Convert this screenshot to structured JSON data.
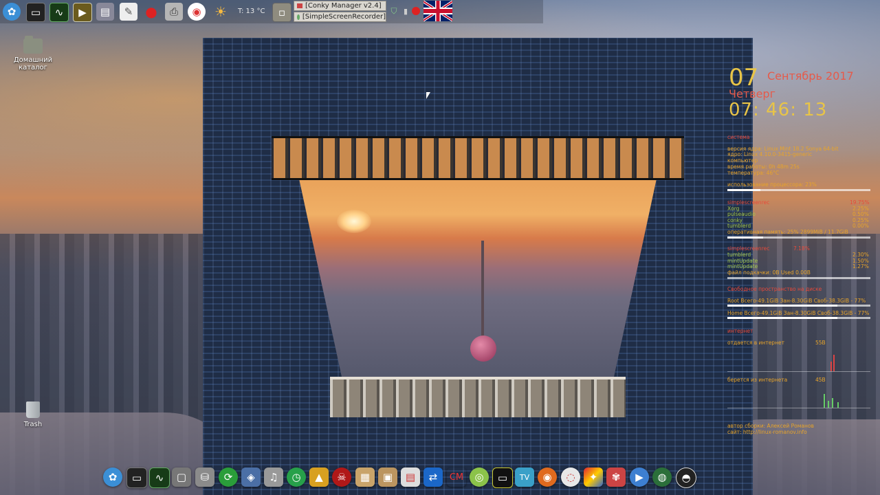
{
  "top_panel": {
    "weather": "T: 13 °C",
    "tasks": [
      "[Conky Manager v2.4]",
      "[SimpleScreenRecorder]"
    ]
  },
  "desktop": {
    "home_folder": "Домашний каталог",
    "trash": "Trash"
  },
  "conky": {
    "day": "07",
    "month_year": "Сентябрь 2017",
    "weekday": "Четверг",
    "time": "07: 46: 13",
    "lines": [
      "система",
      "версия ядра: Linux Mint 18.2 Sonya 64-bit",
      "ядро: Linux 4.10.0-3415-generic",
      "компьютер",
      "время работы: 0h 48m 25s",
      "температура: 46°C",
      "использование процессора: 23%",
      "simplescreenrec",
      "Xorg",
      "pulseaudio",
      "conky",
      "tumblerd",
      "оперативная память: 25% 2899MiB / 11.7GiB",
      "simplescreenrec",
      "tumblerd",
      "mintUpdate",
      "mintUpdate",
      "файл подкачки: 0B Used 0.00B",
      "Свободное пространство на диске",
      "Root Всего-49.1GiB Зан-8.30GiB Своб-38.3GiB - 77%",
      "Home Всего-49.1GiB Зан-8.30GiB Своб-38.3GiB - 77%",
      "интернет",
      "отдается в интернет",
      "берется из интернета",
      "автор сборки: Алексей Романов",
      "сайт: http://linux-romanov.info"
    ],
    "percents_top": [
      "19.75%",
      "2.25%",
      "0.50%",
      "0.25%",
      "0.00%"
    ],
    "percents_mem": [
      "7.18%",
      "2.30%",
      "1.50%",
      "1.27%"
    ],
    "cpu_usage_pct": 23,
    "mem_usage_pct": 25,
    "root_disk_pct": 77,
    "home_disk_pct": 77,
    "upload_rate": "55B",
    "download_rate": "45B"
  },
  "dock": {
    "icons": [
      "kde-icon",
      "terminal-icon",
      "system-monitor-icon",
      "monitor-icon",
      "drive-icon",
      "update-icon",
      "virtualbox-icon",
      "music-icon",
      "clock-icon",
      "penguin-icon",
      "game-icon",
      "archive-icon",
      "package-icon",
      "package-manager-icon",
      "teamviewer-icon",
      "cm-icon",
      "android-icon",
      "screen-icon",
      "tv-icon",
      "firefox-icon",
      "baseball-icon",
      "paint-icon",
      "wine-icon",
      "player-icon",
      "globe-icon",
      "obs-icon"
    ]
  }
}
